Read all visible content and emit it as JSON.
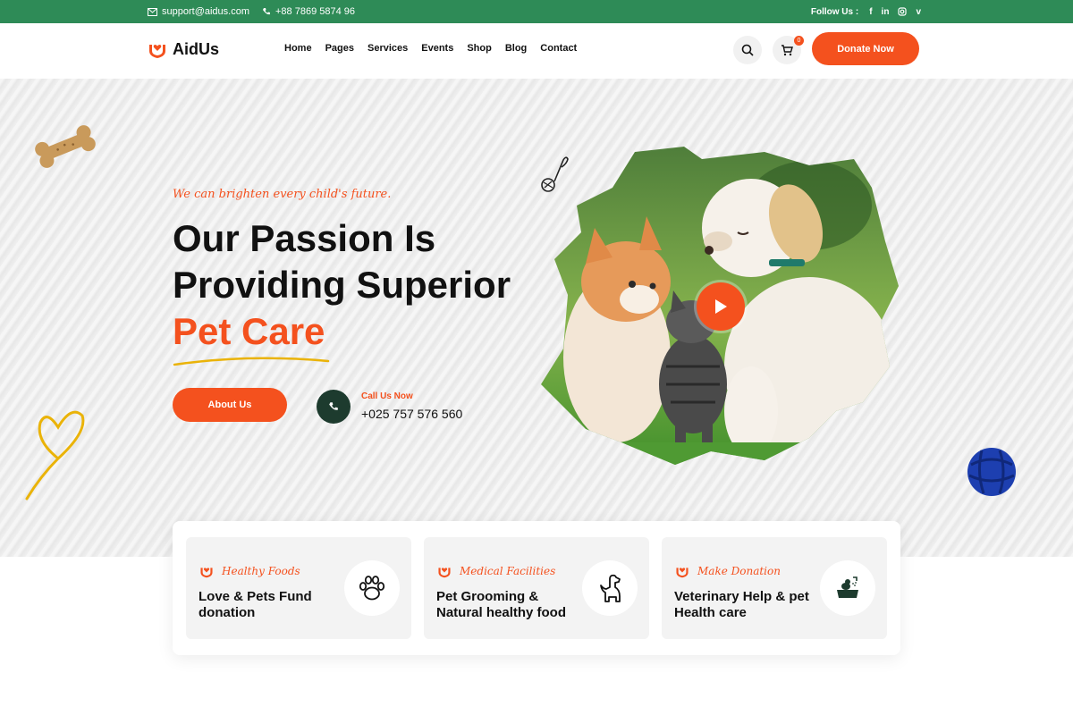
{
  "topbar": {
    "email": "support@aidus.com",
    "phone": "+88 7869 5874 96",
    "follow_label": "Follow Us :",
    "social": [
      "f",
      "in",
      "ig",
      "v"
    ]
  },
  "header": {
    "logo_text": "AidUs",
    "nav": [
      "Home",
      "Pages",
      "Services",
      "Events",
      "Shop",
      "Blog",
      "Contact"
    ],
    "cart_count": "0",
    "donate_label": "Donate Now"
  },
  "hero": {
    "tagline": "We can brighten every child's future.",
    "headline_1": "Our Passion Is",
    "headline_2": "Providing Superior",
    "headline_3": "Pet Care",
    "about_label": "About Us",
    "call_label": "Call Us Now",
    "call_number": "+025 757 576 560"
  },
  "features": [
    {
      "subtitle": "Healthy Foods",
      "title": "Love & Pets Fund donation",
      "icon": "paw-icon"
    },
    {
      "subtitle": "Medical Facilities",
      "title": "Pet Grooming & Natural healthy food",
      "icon": "dog-icon"
    },
    {
      "subtitle": "Make Donation",
      "title": "Veterinary Help & pet Health care",
      "icon": "pet-bath-icon"
    }
  ],
  "colors": {
    "brand_orange": "#f4511e",
    "topbar_green": "#2e8b57",
    "dark_green": "#1d3b2e"
  }
}
